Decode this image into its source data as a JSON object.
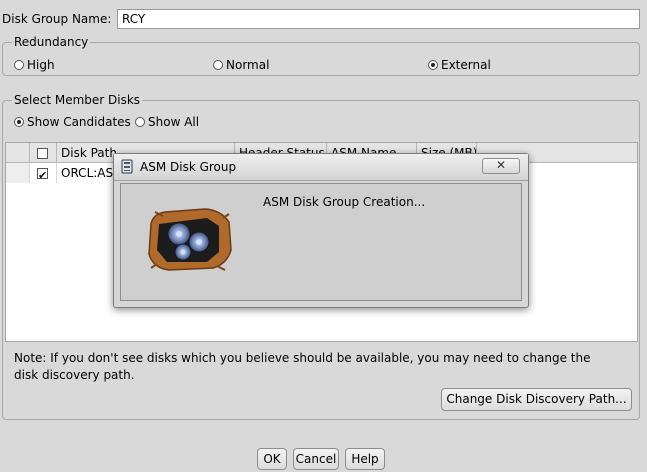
{
  "disk_group": {
    "name_label": "Disk Group Name:",
    "name_value": "RCY"
  },
  "redundancy": {
    "title": "Redundancy",
    "options": [
      {
        "label": "High",
        "selected": false
      },
      {
        "label": "Normal",
        "selected": false
      },
      {
        "label": "External",
        "selected": true
      }
    ]
  },
  "member_disks": {
    "title": "Select Member Disks",
    "filters": [
      {
        "label": "Show Candidates",
        "selected": true
      },
      {
        "label": "Show All",
        "selected": false
      }
    ],
    "columns": [
      "",
      "Disk Path",
      "Header Status",
      "ASM Name",
      "Size (MB)"
    ],
    "rows": [
      {
        "checked": true,
        "disk_path": "ORCL:ASM",
        "header_status": "",
        "asm_name": "",
        "size_mb": ""
      }
    ],
    "note": "Note: If you don't see disks which you believe should be available, you may need to change the disk discovery path.",
    "change_path_button": "Change Disk Discovery Path..."
  },
  "buttons": {
    "ok": "OK",
    "cancel": "Cancel",
    "help": "Help"
  },
  "dialog": {
    "title": "ASM Disk Group",
    "message": "ASM Disk Group Creation...",
    "close_glyph": "✕",
    "icon": "asm-progress-icon"
  }
}
